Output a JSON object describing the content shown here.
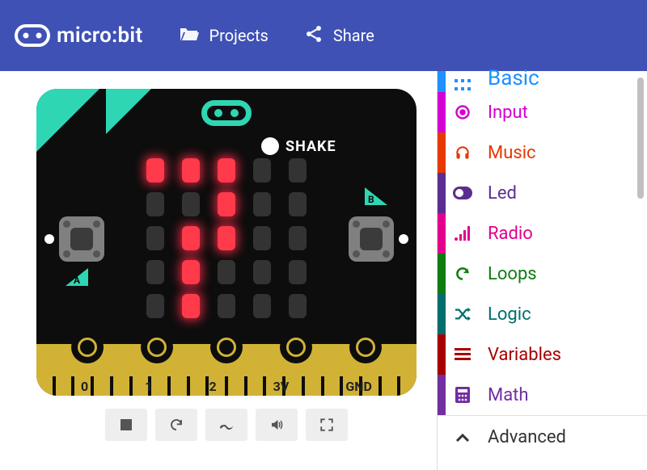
{
  "header": {
    "brand": "micro:bit",
    "projects_label": "Projects",
    "share_label": "Share"
  },
  "simulator": {
    "shake_label": "SHAKE",
    "button_a_label": "A",
    "button_b_label": "B",
    "pins": [
      "0",
      "1",
      "2",
      "3V",
      "GND"
    ],
    "led_matrix": [
      [
        1,
        1,
        1,
        0,
        0
      ],
      [
        0,
        0,
        1,
        0,
        0
      ],
      [
        0,
        1,
        1,
        0,
        0
      ],
      [
        0,
        1,
        0,
        0,
        0
      ],
      [
        0,
        1,
        0,
        0,
        0
      ]
    ],
    "controls": {
      "stop": "stop",
      "restart": "restart",
      "slow": "slow-mo",
      "audio": "mute",
      "fullscreen": "fullscreen"
    }
  },
  "toolbox": {
    "categories": [
      {
        "id": "basic",
        "label": "Basic",
        "icon": "grid-icon"
      },
      {
        "id": "input",
        "label": "Input",
        "icon": "target-icon"
      },
      {
        "id": "music",
        "label": "Music",
        "icon": "headphones-icon"
      },
      {
        "id": "led",
        "label": "Led",
        "icon": "toggle-icon"
      },
      {
        "id": "radio",
        "label": "Radio",
        "icon": "bars-icon"
      },
      {
        "id": "loops",
        "label": "Loops",
        "icon": "cycle-icon"
      },
      {
        "id": "logic",
        "label": "Logic",
        "icon": "shuffle-icon"
      },
      {
        "id": "variables",
        "label": "Variables",
        "icon": "list-icon"
      },
      {
        "id": "math",
        "label": "Math",
        "icon": "calculator-icon"
      }
    ],
    "advanced_label": "Advanced"
  }
}
